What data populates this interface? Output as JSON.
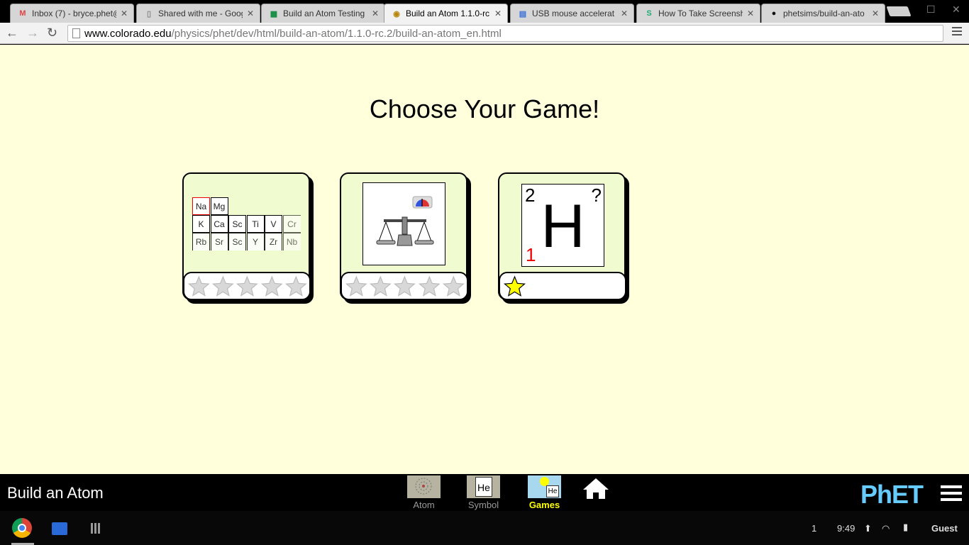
{
  "browser": {
    "tabs": [
      {
        "title": "Inbox (7) - bryce.phet@",
        "icon": "gmail-icon",
        "active": false
      },
      {
        "title": "Shared with me - Google",
        "icon": "document-icon",
        "active": false
      },
      {
        "title": "Build an Atom Testing",
        "icon": "sheets-icon",
        "active": false
      },
      {
        "title": "Build an Atom 1.1.0-rc",
        "icon": "cu-logo-icon",
        "active": true
      },
      {
        "title": "USB mouse accelerat",
        "icon": "docs-icon",
        "active": false
      },
      {
        "title": "How To Take Screensh",
        "icon": "web-icon",
        "active": false
      },
      {
        "title": "phetsims/build-an-ato",
        "icon": "github-icon",
        "active": false
      }
    ],
    "url_host": "www.colorado.edu",
    "url_path": "/physics/phet/dev/html/build-an-atom/1.1.0-rc.2/build-an-atom_en.html"
  },
  "game": {
    "heading": "Choose Your Game!",
    "levels": [
      {
        "name": "periodic-table-game",
        "stars_earned": 0,
        "stars_total": 5,
        "cells": [
          "Na",
          "Mg",
          "K",
          "Ca",
          "Sc",
          "Ti",
          "V",
          "Cr",
          "Rb",
          "Sr",
          "Sc",
          "Y",
          "Zr",
          "Nb"
        ]
      },
      {
        "name": "mass-and-charge-game",
        "stars_earned": 0,
        "stars_total": 5
      },
      {
        "name": "symbol-game",
        "stars_earned": 1,
        "stars_total": 1,
        "symbol": "H",
        "mass_number": "2",
        "atomic_number": "1",
        "charge": "?"
      }
    ]
  },
  "navbar": {
    "sim_title": "Build an Atom",
    "screens": [
      {
        "label": "Atom",
        "selected": false
      },
      {
        "label": "Symbol",
        "selected": false
      },
      {
        "label": "Games",
        "selected": true
      }
    ],
    "thumb_symbol": "He",
    "logo": "PhET"
  },
  "shelf": {
    "notification_count": "1",
    "time": "9:49",
    "user": "Guest"
  },
  "colors": {
    "page_bg": "#ffffdc",
    "card_bg": "#f0fcd0",
    "selected_screen": "#ffff00"
  }
}
